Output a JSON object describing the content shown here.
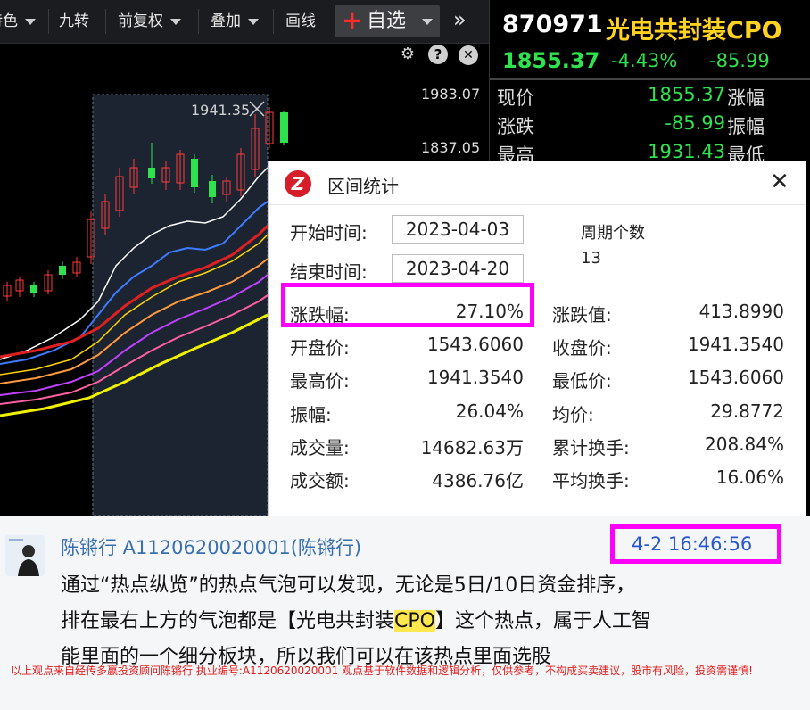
{
  "toolbar": {
    "items": [
      "特色",
      "九转",
      "前复权",
      "叠加",
      "画线"
    ],
    "zixuan_label": "自选",
    "more_glyph": "»"
  },
  "chart": {
    "y_labels": [
      "1983.07",
      "1837.05"
    ],
    "region_high_label": "1941.35"
  },
  "quote": {
    "code": "870971",
    "name": "光电共封装CPO",
    "price": "1855.37",
    "change_pct": "-4.43%",
    "change": "-85.99",
    "rows": [
      {
        "label": "现价",
        "value": "1855.37",
        "right": "涨幅"
      },
      {
        "label": "涨跌",
        "value": "-85.99",
        "right": "振幅"
      },
      {
        "label": "最高",
        "value": "1931.43",
        "right": "最低"
      }
    ]
  },
  "dialog": {
    "title": "区间统计",
    "start_label": "开始时间:",
    "start_value": "2023-04-03",
    "end_label": "结束时间:",
    "end_value": "2023-04-20",
    "period_label": "周期个数",
    "period_value": "13",
    "stats_left": [
      {
        "label": "涨跌幅:",
        "value": "27.10%"
      },
      {
        "label": "开盘价:",
        "value": "1543.6060"
      },
      {
        "label": "最高价:",
        "value": "1941.3540"
      },
      {
        "label": "振幅:",
        "value": "26.04%"
      },
      {
        "label": "成交量:",
        "value": "14682.63万"
      },
      {
        "label": "成交额:",
        "value": "4386.76亿"
      }
    ],
    "stats_right": [
      {
        "label": "涨跌值:",
        "value": "413.8990"
      },
      {
        "label": "收盘价:",
        "value": "1941.3540"
      },
      {
        "label": "最低价:",
        "value": "1543.6060"
      },
      {
        "label": "均价:",
        "value": "29.8772"
      },
      {
        "label": "累计换手:",
        "value": "208.84%"
      },
      {
        "label": "平均换手:",
        "value": "16.06%"
      }
    ]
  },
  "post": {
    "author": "陈锵行 A1120620020001(陈锵行)",
    "time": "4-2 16:46:56",
    "line1": "通过“热点纵览”的热点气泡可以发现，无论是5日/10日资金排序，",
    "line2_pre": "排在最右上方的气泡都是【光电共封装",
    "line2_hl": "CPO",
    "line2_post": "】这个热点，属于人工智",
    "line3": "能里面的一个细分板块，所以我们可以在该热点里面选股",
    "disclaimer": "以上观点来自经传多赢投资顾问陈锵行 执业编号:A1120620020001 观点基于软件数据和逻辑分析，仅供参考，不构成买卖建议，股市有风险，投资需谨慎!"
  },
  "colors": {
    "up": "#ff3b3b",
    "down": "#2fe24e",
    "highlight": "#ff00ff",
    "name": "#ffd21f"
  }
}
